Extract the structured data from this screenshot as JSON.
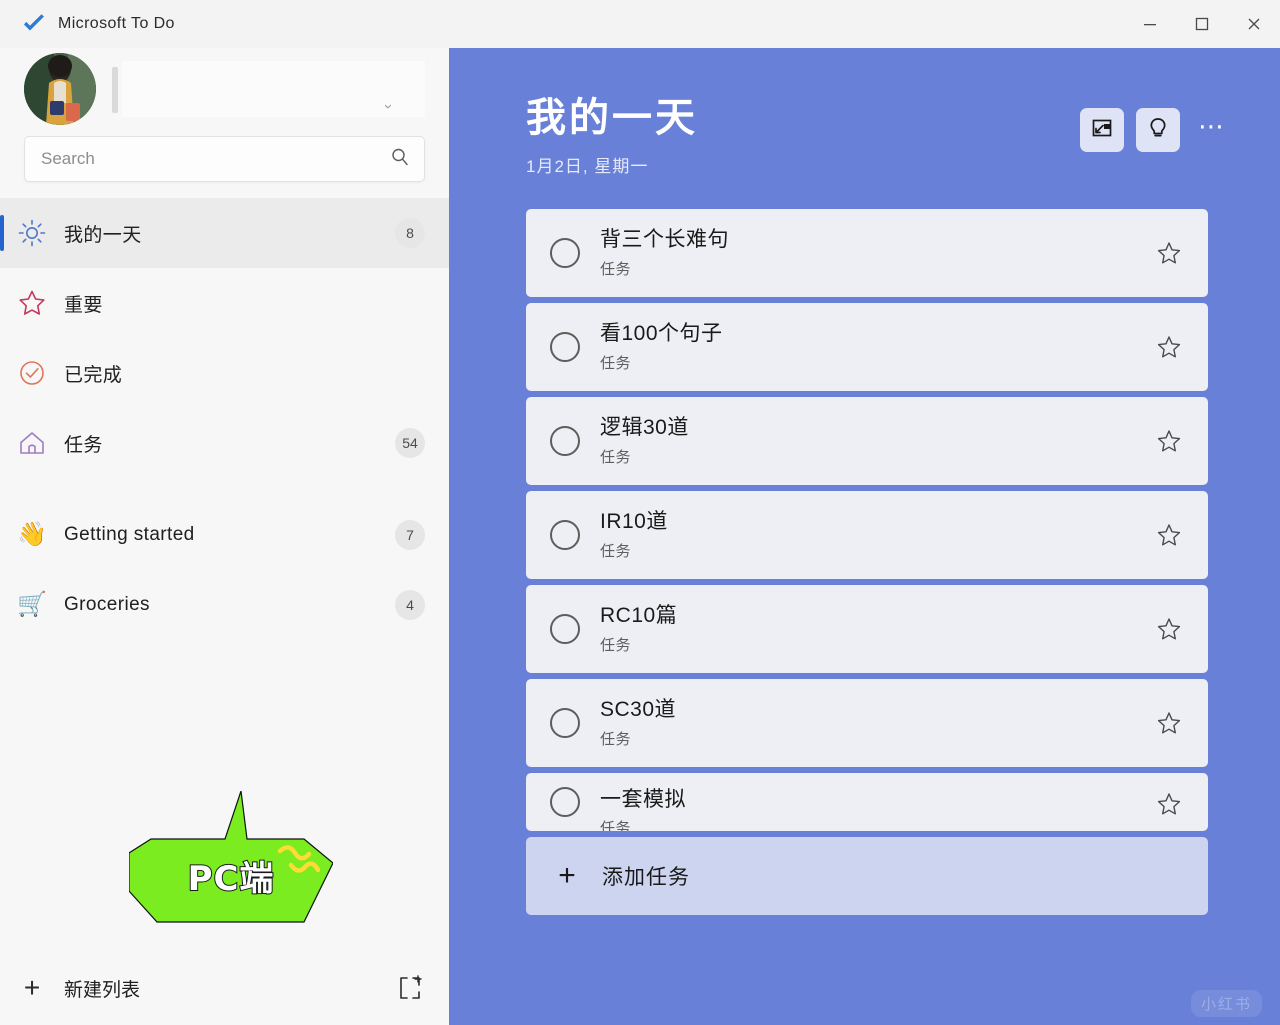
{
  "window": {
    "app_title": "Microsoft To Do",
    "logo_icon": "checkmark-logo-icon",
    "controls": {
      "minimize": "—",
      "maximize": "☐",
      "close": "✕"
    }
  },
  "sidebar": {
    "account": {
      "avatar_alt": "user-avatar",
      "name": "",
      "expand_icon": "chevron-icon"
    },
    "search": {
      "value": "",
      "placeholder": "Search",
      "icon": "search-icon"
    },
    "nav_groups": [
      {
        "items": [
          {
            "icon": "sun-icon",
            "emoji": "",
            "label": "我的一天",
            "count": "8",
            "selected": true
          },
          {
            "icon": "star-icon",
            "emoji": "",
            "label": "重要",
            "count": "",
            "selected": false
          },
          {
            "icon": "check-circle-icon",
            "emoji": "",
            "label": "已完成",
            "count": "",
            "selected": false
          },
          {
            "icon": "home-icon",
            "emoji": "",
            "label": "任务",
            "count": "54",
            "selected": false
          }
        ]
      },
      {
        "items": [
          {
            "icon": "waving-hand-icon",
            "emoji": "👋",
            "label": "Getting started",
            "count": "7",
            "selected": false
          },
          {
            "icon": "shopping-cart-icon",
            "emoji": "🛒",
            "label": "Groceries",
            "count": "4",
            "selected": false
          }
        ]
      }
    ],
    "annotation": {
      "text": "PC端",
      "bubble_color": "#7aec20",
      "squiggle_color": "#ffdb33"
    },
    "footer": {
      "plus_icon": "plus-icon",
      "new_list_label": "新建列表",
      "new_group_icon": "new-group-icon"
    }
  },
  "main": {
    "background_color": "#6880d8",
    "title": "我的一天",
    "subtitle": "1月2日, 星期一",
    "actions": [
      {
        "icon": "change-background-icon",
        "name": "change-theme-button"
      },
      {
        "icon": "lightbulb-icon",
        "name": "suggestions-button"
      }
    ],
    "more_glyph": "⋯",
    "tasks": [
      {
        "title": "背三个长难句",
        "meta": "任务",
        "starred": false
      },
      {
        "title": "看100个句子",
        "meta": "任务",
        "starred": false
      },
      {
        "title": "逻辑30道",
        "meta": "任务",
        "starred": false
      },
      {
        "title": "IR10道",
        "meta": "任务",
        "starred": false
      },
      {
        "title": "RC10篇",
        "meta": "任务",
        "starred": false
      },
      {
        "title": "SC30道",
        "meta": "任务",
        "starred": false
      },
      {
        "title": "一套模拟",
        "meta": "任务",
        "starred": false
      }
    ],
    "add_task": {
      "plus": "+",
      "label": "添加任务"
    },
    "watermark": "小红书"
  }
}
